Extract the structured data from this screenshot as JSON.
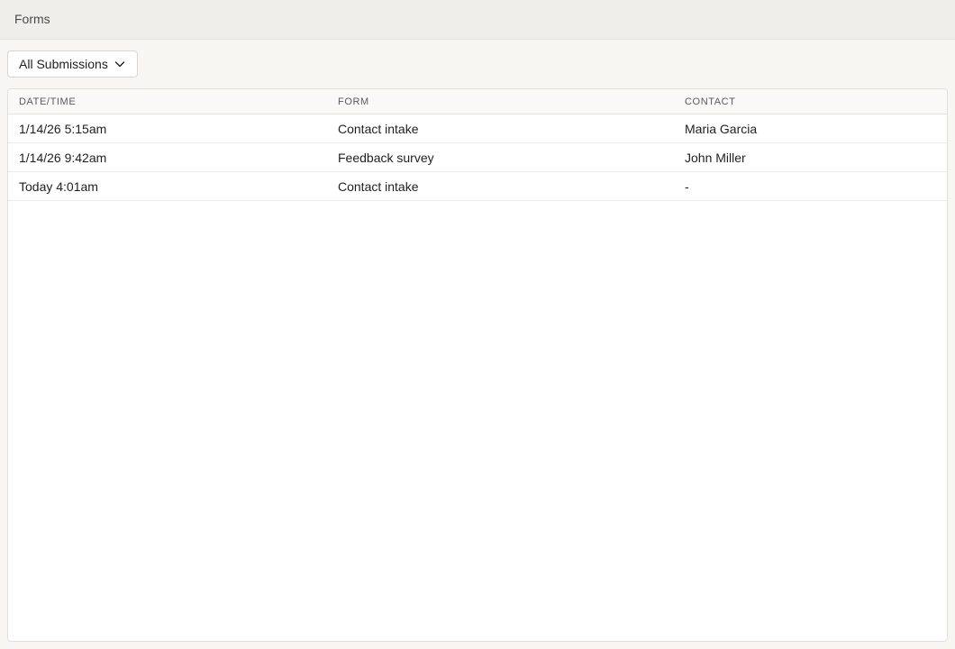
{
  "header": {
    "breadcrumb": "Forms"
  },
  "filter": {
    "label": "All Submissions",
    "icon": "chevron-down-icon"
  },
  "table": {
    "columns": [
      "DATE/TIME",
      "FORM",
      "CONTACT"
    ],
    "rows": [
      {
        "datetime": "1/14/26 5:15am",
        "form": "Contact intake",
        "contact": "Maria Garcia"
      },
      {
        "datetime": "1/14/26 9:42am",
        "form": "Feedback survey",
        "contact": "John Miller"
      },
      {
        "datetime": "Today 4:01am",
        "form": "Contact intake",
        "contact": "-"
      }
    ]
  }
}
